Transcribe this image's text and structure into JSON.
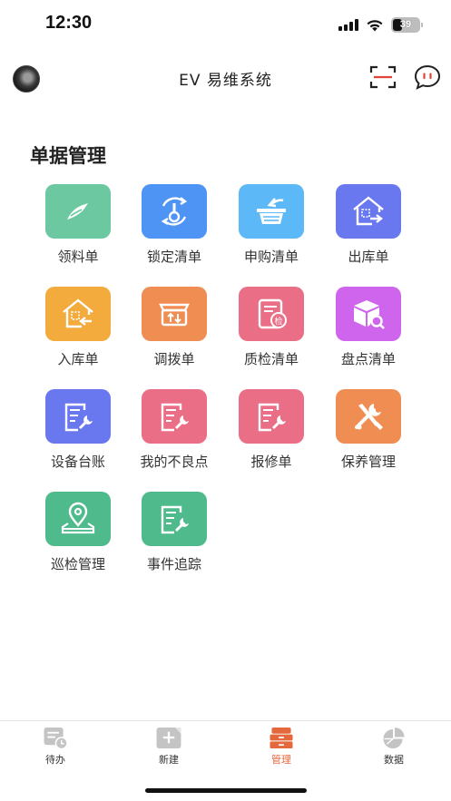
{
  "status_bar": {
    "time": "12:30",
    "battery_level": "39"
  },
  "header": {
    "title": "EV 易维系统"
  },
  "section": {
    "title": "单据管理"
  },
  "tiles": [
    {
      "label": "领料单",
      "icon": "requisition-icon",
      "color": "#6cc8a0"
    },
    {
      "label": "锁定清单",
      "icon": "lock-list-icon",
      "color": "#4d94f4"
    },
    {
      "label": "申购清单",
      "icon": "purchase-request-icon",
      "color": "#5db8f7"
    },
    {
      "label": "出库单",
      "icon": "outbound-icon",
      "color": "#6a78f0"
    },
    {
      "label": "入库单",
      "icon": "inbound-icon",
      "color": "#f2ab3c"
    },
    {
      "label": "调拨单",
      "icon": "transfer-icon",
      "color": "#ef8d52"
    },
    {
      "label": "质检清单",
      "icon": "quality-check-icon",
      "color": "#ea6f86"
    },
    {
      "label": "盘点清单",
      "icon": "inventory-count-icon",
      "color": "#cf64ed"
    },
    {
      "label": "设备台账",
      "icon": "equipment-ledger-icon",
      "color": "#6a78f0"
    },
    {
      "label": "我的不良点",
      "icon": "defects-icon",
      "color": "#ea6f86"
    },
    {
      "label": "报修单",
      "icon": "repair-request-icon",
      "color": "#ea6f86"
    },
    {
      "label": "保养管理",
      "icon": "maintenance-icon",
      "color": "#ef8d52"
    },
    {
      "label": "巡检管理",
      "icon": "patrol-icon",
      "color": "#4fbb8c"
    },
    {
      "label": "事件追踪",
      "icon": "event-tracking-icon",
      "color": "#4fbb8c"
    }
  ],
  "tabs": [
    {
      "label": "待办",
      "icon": "todo-icon",
      "active": false
    },
    {
      "label": "新建",
      "icon": "new-icon",
      "active": false
    },
    {
      "label": "管理",
      "icon": "manage-icon",
      "active": true
    },
    {
      "label": "数据",
      "icon": "data-icon",
      "active": false
    }
  ],
  "colors": {
    "accent": "#e4683c",
    "tab_inactive_icon": "#c4c4c4"
  }
}
